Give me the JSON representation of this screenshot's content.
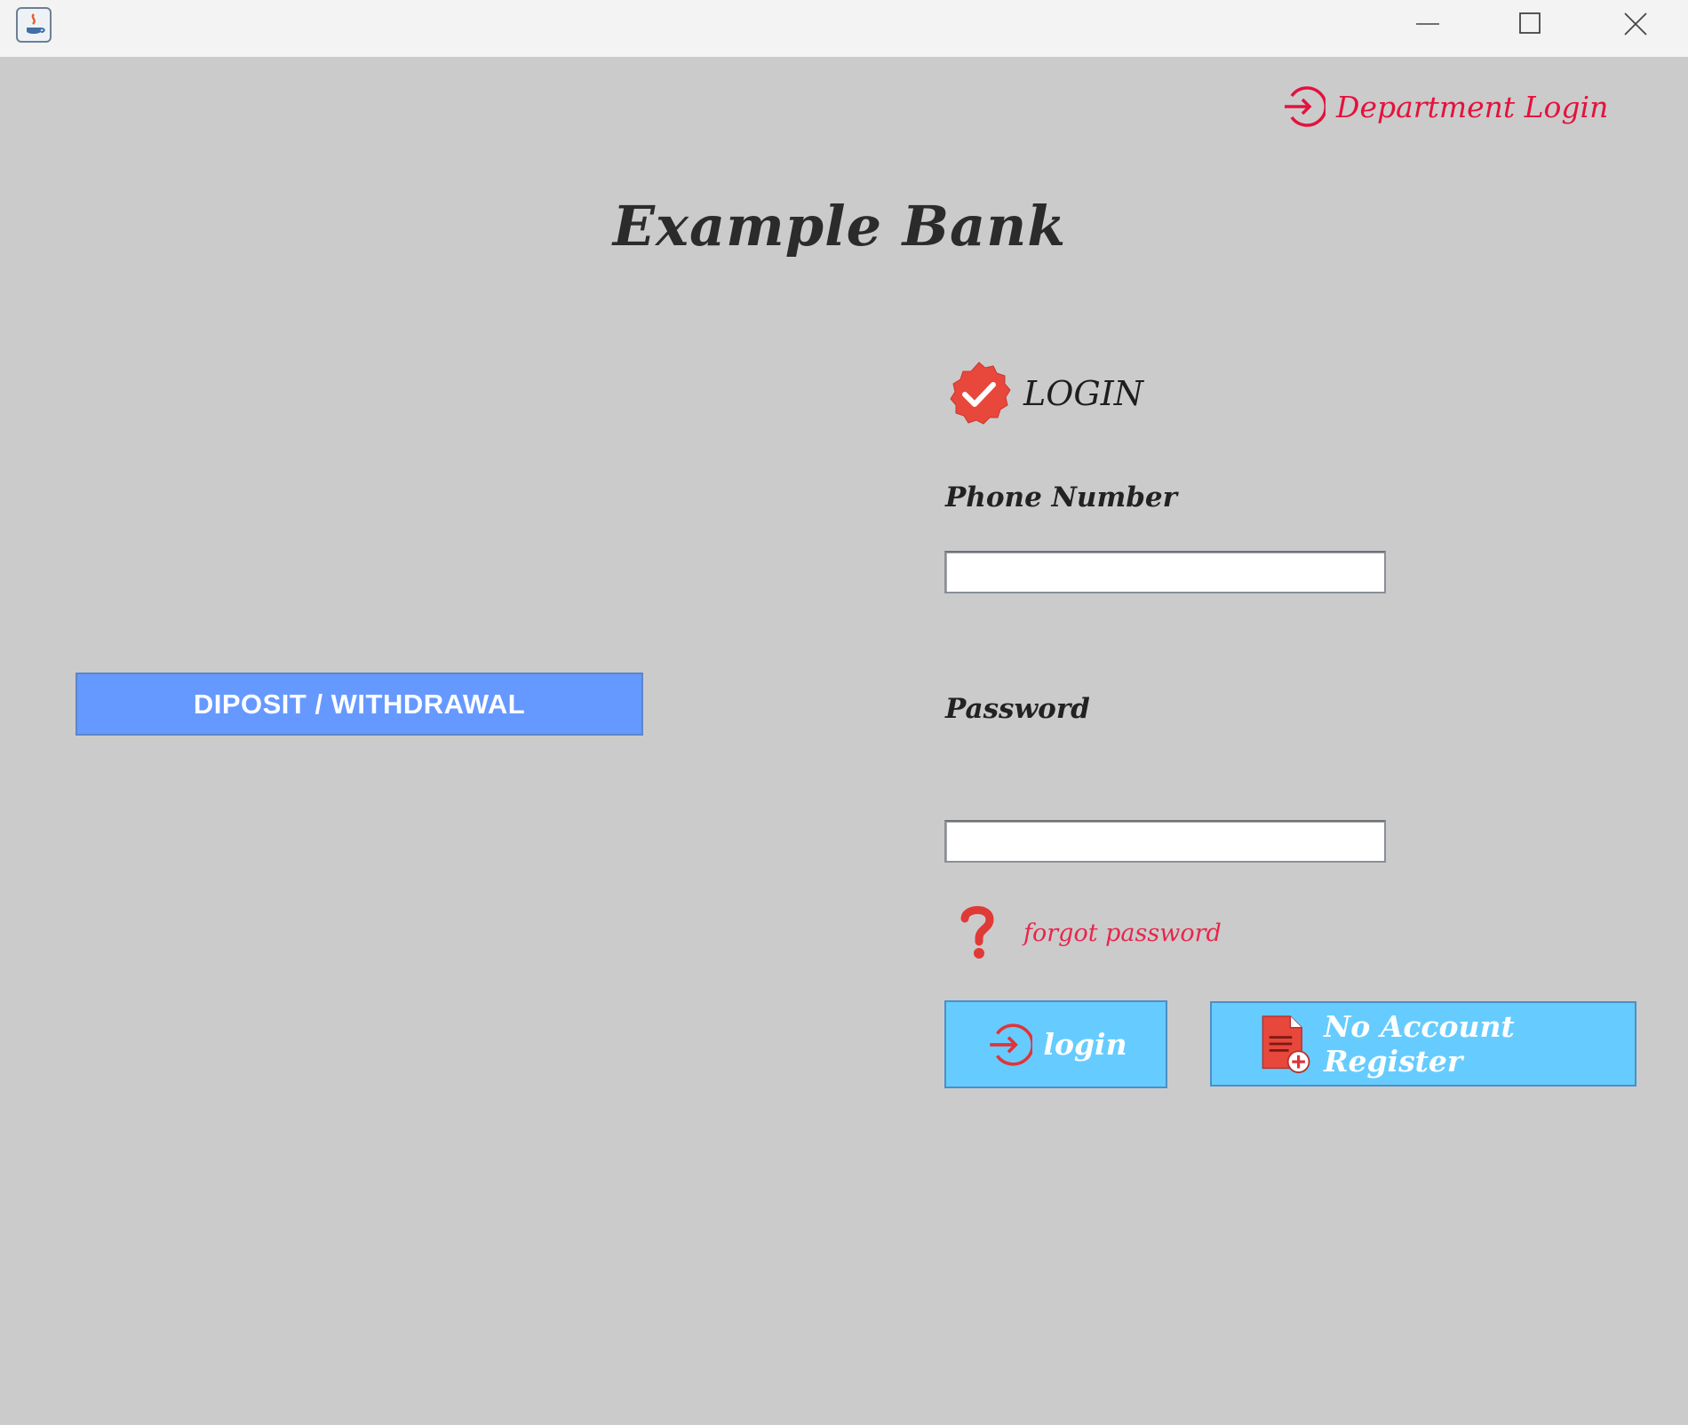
{
  "window": {
    "app_icon": "java-icon",
    "controls": [
      "minimize-icon",
      "maximize-icon",
      "close-icon"
    ]
  },
  "header": {
    "department_login_label": "Department Login",
    "department_login_icon": "sign-in-arrow-icon"
  },
  "page_title": "Example Bank",
  "login_form": {
    "heading": "LOGIN",
    "heading_icon": "check-badge-icon",
    "phone_label": "Phone Number",
    "phone_value": "",
    "password_label": "Password",
    "password_value": "",
    "forgot_password_label": "forgot password",
    "forgot_password_icon": "question-mark-icon",
    "login_button_label": "login",
    "register_button_label": "No Account Register"
  },
  "side_action": {
    "deposit_withdrawal_label": "DIPOSIT / WITHDRAWAL"
  },
  "colors": {
    "background": "#cbcbcb",
    "accent_red": "#e4123d",
    "button_blue": "#66ccff",
    "action_blue": "#6699ff"
  }
}
